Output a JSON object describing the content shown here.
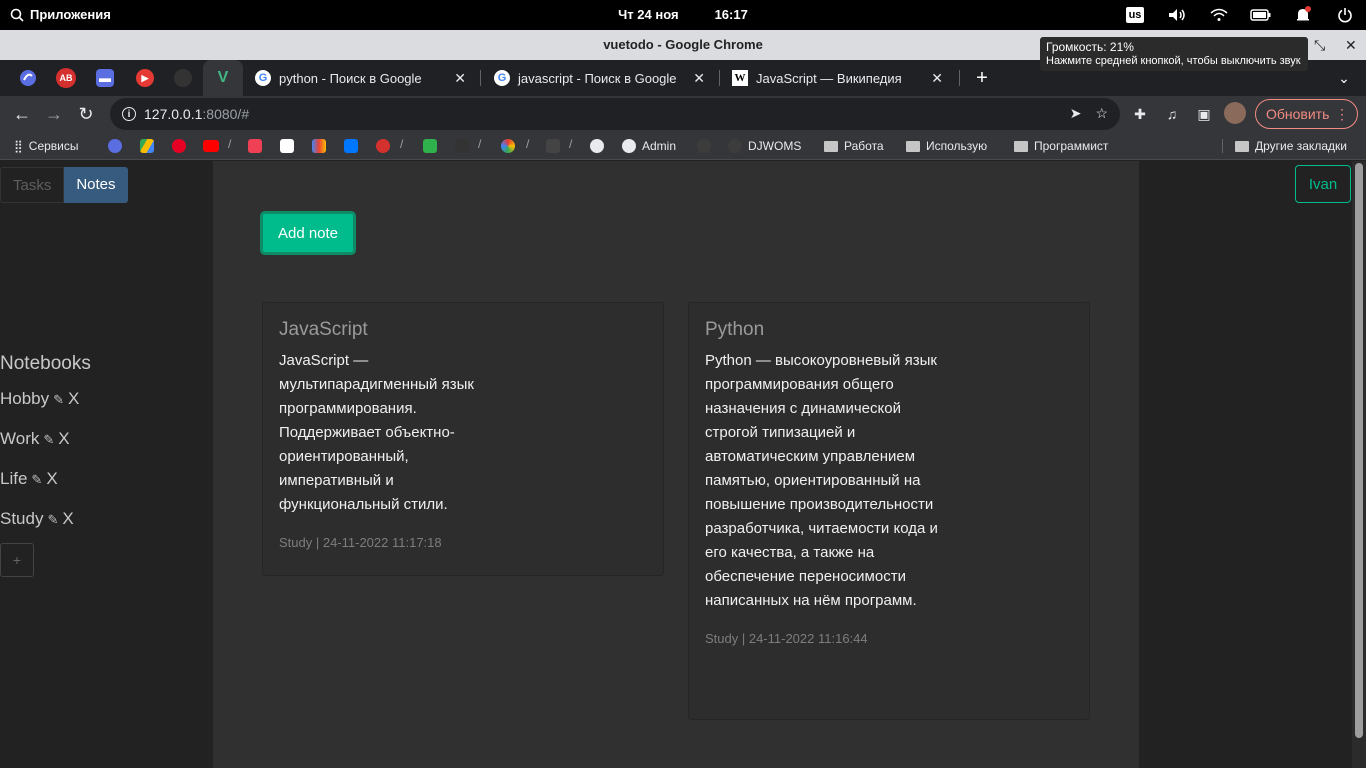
{
  "os": {
    "apps_label": "Приложения",
    "date": "Чт 24 ноя",
    "time": "16:17",
    "kbd_layout": "us"
  },
  "window": {
    "title": "vuetodo - Google Chrome"
  },
  "volume_tooltip": {
    "line1": "Громкость: 21%",
    "line2": "Нажмите средней кнопкой, чтобы выключить звук"
  },
  "tabs": [
    {
      "label": "python - Поиск в Google",
      "icon": "google-icon"
    },
    {
      "label": "javascript - Поиск в Google",
      "icon": "google-icon"
    },
    {
      "label": "JavaScript — Википедия",
      "icon": "wikipedia-icon"
    }
  ],
  "address": {
    "host": "127.0.0.1",
    "rest": ":8080/#"
  },
  "toolbar": {
    "update_label": "Обновить"
  },
  "bookmarks": {
    "services": "Сервисы",
    "admin": "Admin",
    "djwoms": "DJWOMS",
    "work": "Работа",
    "using": "Использую",
    "programmer": "Программист",
    "other": "Другие закладки"
  },
  "app": {
    "tabs": {
      "tasks": "Tasks",
      "notes": "Notes"
    },
    "user": "Ivan",
    "add_note": "Add note",
    "notebooks_title": "Notebooks",
    "notebooks": [
      {
        "name": "Hobby"
      },
      {
        "name": "Work"
      },
      {
        "name": "Life"
      },
      {
        "name": "Study"
      }
    ],
    "notebook_delete": "X",
    "notebook_add": "+",
    "notes": [
      {
        "title": "JavaScript",
        "body": "JavaScript — мультипарадигменный язык программирования. Поддерживает объектно-ориентированный, императивный и функциональный стили.",
        "meta": "Study | 24-11-2022 11:17:18"
      },
      {
        "title": "Python",
        "body": "Python — высокоуровневый язык программирования общего назначения с динамической строгой типизацией и автоматическим управлением памятью, ориентированный на повышение производительности разработчика, читаемости кода и его качества, а также на обеспечение переносимости написанных на нём программ.",
        "meta": "Study | 24-11-2022 11:16:44"
      }
    ]
  },
  "colors": {
    "accent": "#00bc8c",
    "tab_active": "#375a7f",
    "update": "#f28b82"
  }
}
